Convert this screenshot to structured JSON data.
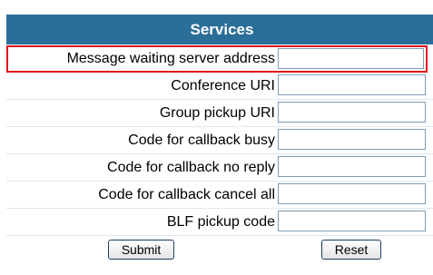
{
  "section": {
    "title": "Services"
  },
  "fields": [
    {
      "label": "Message waiting server address",
      "value": ""
    },
    {
      "label": "Conference URI",
      "value": ""
    },
    {
      "label": "Group pickup URI",
      "value": ""
    },
    {
      "label": "Code for callback busy",
      "value": ""
    },
    {
      "label": "Code for callback no reply",
      "value": ""
    },
    {
      "label": "Code for callback cancel all",
      "value": ""
    },
    {
      "label": "BLF pickup code",
      "value": ""
    }
  ],
  "buttons": {
    "submit_label": "Submit",
    "reset_label": "Reset"
  },
  "colors": {
    "header_bg": "#2b6f99",
    "highlight_border": "#e0151c"
  }
}
